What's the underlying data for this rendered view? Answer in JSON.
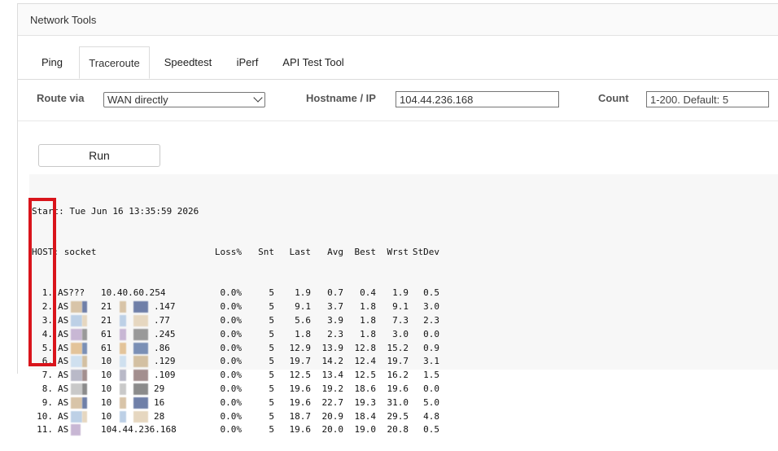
{
  "panel": {
    "title": "Network Tools"
  },
  "tabs": [
    {
      "label": "Ping",
      "active": false
    },
    {
      "label": "Traceroute",
      "active": true
    },
    {
      "label": "Speedtest",
      "active": false
    },
    {
      "label": "iPerf",
      "active": false
    },
    {
      "label": "API Test Tool",
      "active": false
    }
  ],
  "form": {
    "route_label": "Route via",
    "route_value": "WAN directly",
    "host_label": "Hostname / IP",
    "host_value": "104.44.236.168",
    "count_label": "Count",
    "count_placeholder": "1-200. Default: 5"
  },
  "run_label": "Run",
  "output": {
    "start_line": "Start: Tue Jun 16 13:35:59 2026",
    "host_label": "HOST: socket",
    "columns": [
      "Loss%",
      "Snt",
      "Last",
      "Avg",
      "Best",
      "Wrst",
      "StDev"
    ],
    "hops": [
      {
        "n": "1.",
        "as": "AS???",
        "ip": "10.40.60.254",
        "loss": "0.0%",
        "snt": "5",
        "last": "1.9",
        "avg": "0.7",
        "best": "0.4",
        "wrst": "1.9",
        "stdev": "0.5"
      },
      {
        "n": "2.",
        "as": "AS",
        "ip": "21",
        "ip_tail": ".147",
        "loss": "0.0%",
        "snt": "5",
        "last": "9.1",
        "avg": "3.7",
        "best": "1.8",
        "wrst": "9.1",
        "stdev": "3.0"
      },
      {
        "n": "3.",
        "as": "AS",
        "ip": "21",
        "ip_tail": ".77",
        "loss": "0.0%",
        "snt": "5",
        "last": "5.6",
        "avg": "3.9",
        "best": "1.8",
        "wrst": "7.3",
        "stdev": "2.3"
      },
      {
        "n": "4.",
        "as": "AS",
        "ip": "61",
        "ip_tail": ".245",
        "loss": "0.0%",
        "snt": "5",
        "last": "1.8",
        "avg": "2.3",
        "best": "1.8",
        "wrst": "3.0",
        "stdev": "0.0"
      },
      {
        "n": "5.",
        "as": "AS",
        "ip": "61",
        "ip_tail": ".86",
        "loss": "0.0%",
        "snt": "5",
        "last": "12.9",
        "avg": "13.9",
        "best": "12.8",
        "wrst": "15.2",
        "stdev": "0.9"
      },
      {
        "n": "6.",
        "as": "AS",
        "ip": "10",
        "ip_tail": ".129",
        "loss": "0.0%",
        "snt": "5",
        "last": "19.7",
        "avg": "14.2",
        "best": "12.4",
        "wrst": "19.7",
        "stdev": "3.1"
      },
      {
        "n": "7.",
        "as": "AS",
        "ip": "10",
        "ip_tail": ".109",
        "loss": "0.0%",
        "snt": "5",
        "last": "12.5",
        "avg": "13.4",
        "best": "12.5",
        "wrst": "16.2",
        "stdev": "1.5"
      },
      {
        "n": "8.",
        "as": "AS",
        "ip": "10",
        "ip_tail": "29",
        "loss": "0.0%",
        "snt": "5",
        "last": "19.6",
        "avg": "19.2",
        "best": "18.6",
        "wrst": "19.6",
        "stdev": "0.0"
      },
      {
        "n": "9.",
        "as": "AS",
        "ip": "10",
        "ip_tail": "16",
        "loss": "0.0%",
        "snt": "5",
        "last": "19.6",
        "avg": "22.7",
        "best": "19.3",
        "wrst": "31.0",
        "stdev": "5.0"
      },
      {
        "n": "10.",
        "as": "AS",
        "ip": "10",
        "ip_tail": "28",
        "loss": "0.0%",
        "snt": "5",
        "last": "18.7",
        "avg": "20.9",
        "best": "18.4",
        "wrst": "29.5",
        "stdev": "4.8"
      },
      {
        "n": "11.",
        "as": "AS",
        "ip": "104.44.236.168",
        "loss": "0.0%",
        "snt": "5",
        "last": "19.6",
        "avg": "20.0",
        "best": "19.0",
        "wrst": "20.8",
        "stdev": "0.5"
      }
    ]
  },
  "colors": {
    "highlight": "#d9141b",
    "border": "#dcdcdc",
    "output_bg": "#f7f7f7"
  }
}
